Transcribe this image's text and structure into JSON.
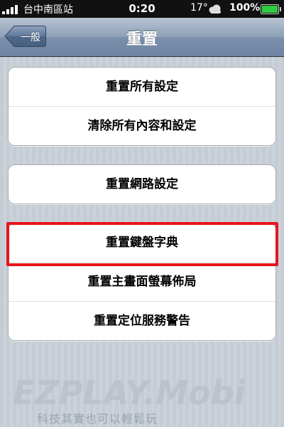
{
  "status_bar": {
    "carrier": "台中南區站",
    "time": "0:20",
    "temperature": "17°",
    "weather_icon": "cloud-icon",
    "battery": "100%"
  },
  "nav": {
    "back_label": "一般",
    "title": "重置"
  },
  "groups": [
    {
      "items": [
        "重置所有設定",
        "清除所有內容和設定"
      ]
    },
    {
      "items": [
        "重置網路設定"
      ]
    },
    {
      "items": [
        "重置鍵盤字典",
        "重置主畫面螢幕佈局",
        "重置定位服務警告"
      ]
    }
  ],
  "highlight_color": "#e8141b",
  "watermark": {
    "logo": "EZPLAY.Mobi",
    "slogan": "科技其實也可以輕鬆玩"
  }
}
